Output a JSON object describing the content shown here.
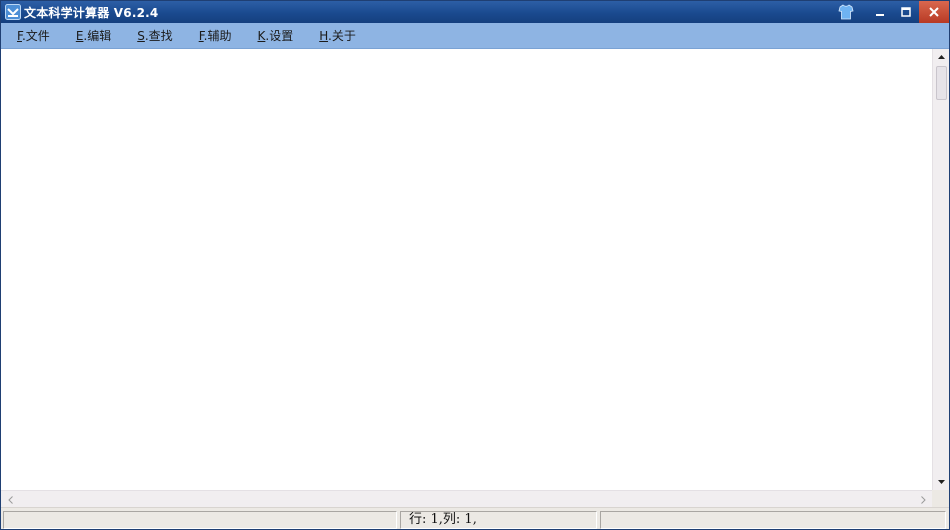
{
  "window": {
    "title": "文本科学计算器 V6.2.4"
  },
  "menu": {
    "items": [
      {
        "key": "F",
        "rest": ".文件"
      },
      {
        "key": "E",
        "rest": ".编辑"
      },
      {
        "key": "S",
        "rest": ".查找"
      },
      {
        "key": "F",
        "rest": ".辅助"
      },
      {
        "key": "K",
        "rest": ".设置"
      },
      {
        "key": "H",
        "rest": ".关于"
      }
    ]
  },
  "editor": {
    "content": ""
  },
  "status": {
    "panel1": "",
    "position": "行: 1,列: 1,",
    "panel3": ""
  },
  "colors": {
    "titlebar": "#1a4a8f",
    "menubar": "#8eb4e3",
    "close_button": "#c4482f"
  },
  "icons": {
    "app": "calculator-app-icon",
    "skin": "shirt-skin-icon",
    "minimize": "minimize-icon",
    "maximize": "maximize-icon",
    "close": "close-icon"
  }
}
